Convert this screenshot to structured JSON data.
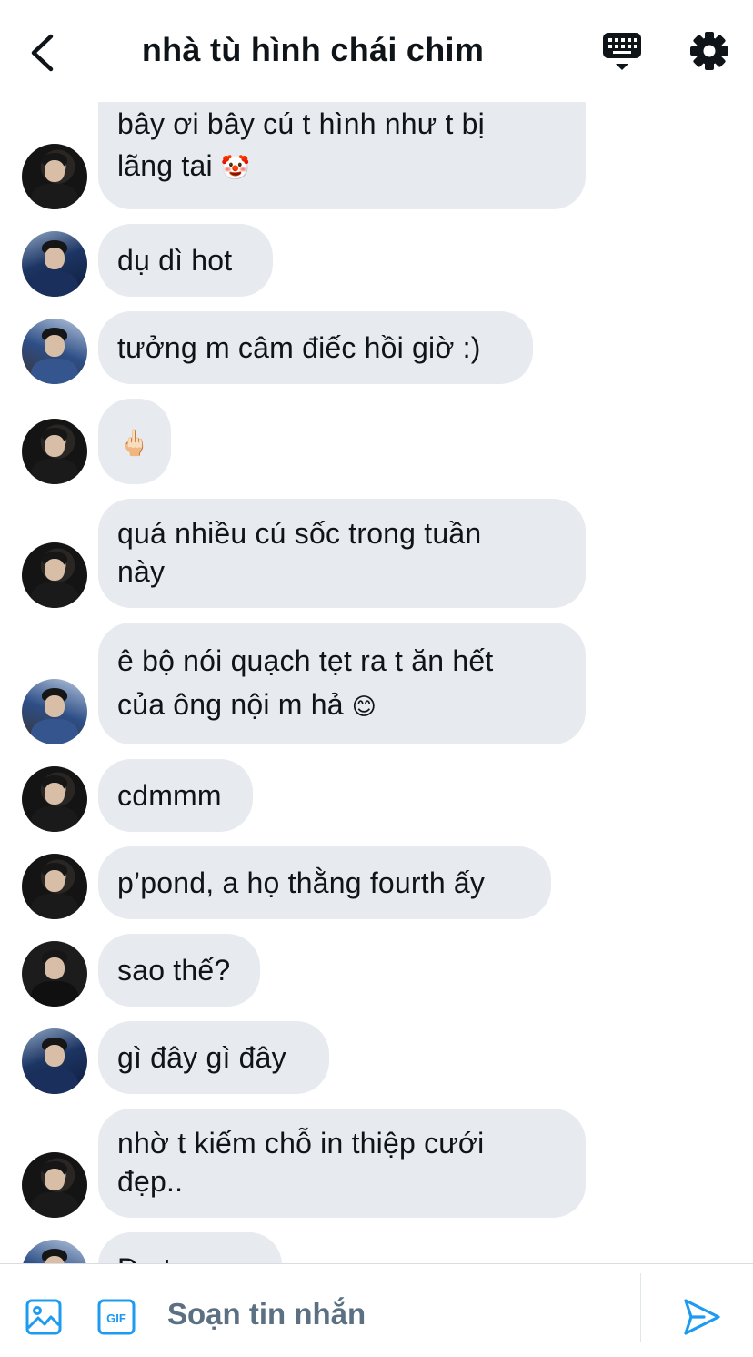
{
  "header": {
    "title": "nhà tù hình chái chim",
    "back_icon": "chevron-left-icon",
    "keyboard_icon": "keyboard-icon",
    "settings_icon": "gear-icon"
  },
  "messages": [
    {
      "text": "bây ơi bây cú t hình như t bị",
      "text2": "lãng tai",
      "emoji": "🤡"
    },
    {
      "text": "dụ dì hot"
    },
    {
      "text": "tưởng m câm điếc hồi giờ :)"
    },
    {
      "emoji": "🖕🏻"
    },
    {
      "text": "quá nhiều cú sốc trong tuần",
      "text2": "này"
    },
    {
      "text": "ê bộ nói quạch tẹt ra t ăn hết",
      "text2": "của ông nội m hả",
      "emoji": "😊"
    },
    {
      "text": "cdmmm"
    },
    {
      "text": "p’pond, a họ thằng fourth ấy"
    },
    {
      "text": "sao thế?"
    },
    {
      "text": "gì đây gì đây"
    },
    {
      "text": "nhờ t kiếm chỗ in thiệp cưới",
      "text2": "đẹp.."
    },
    {
      "text": "Đ...t..."
    }
  ],
  "composer": {
    "placeholder": "Soạn tin nhắn",
    "image_icon": "image-icon",
    "gif_label": "GIF",
    "send_icon": "send-icon"
  },
  "colors": {
    "accent": "#1d9bf0",
    "bubble": "#e7eaee",
    "text": "#0f1419",
    "placeholder": "#5b7083"
  }
}
